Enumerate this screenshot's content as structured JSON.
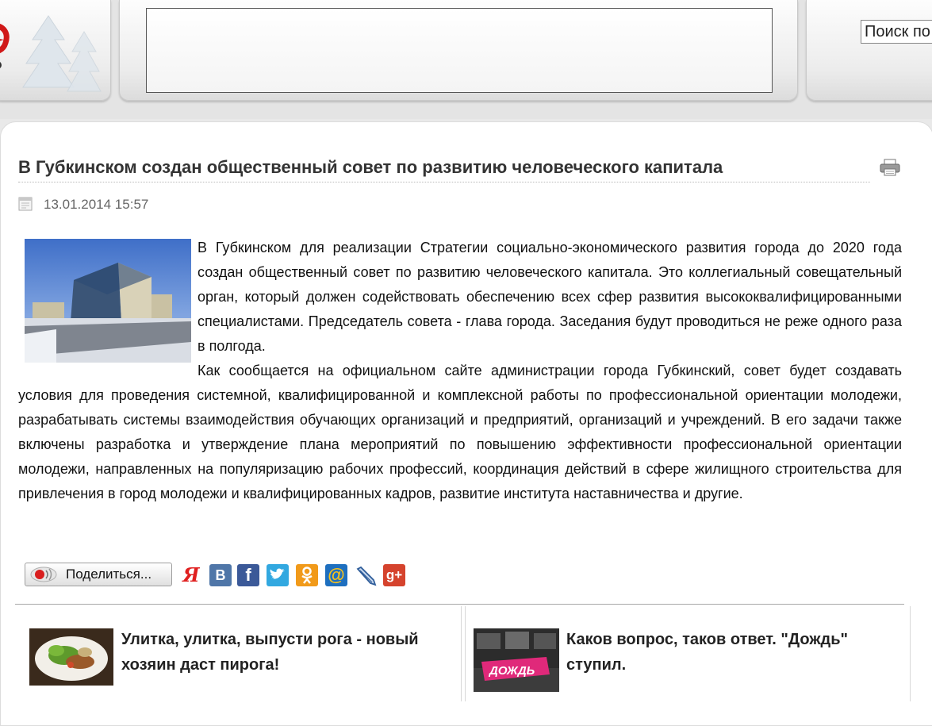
{
  "header": {
    "search_placeholder": "Поиск по сайту"
  },
  "article": {
    "title": "В Губкинском создан общественный совет по развитию человеческого капитала",
    "date": "13.01.2014 15:57",
    "paragraphs": [
      "В Губкинском для реализации Стратегии социально-экономического развития города до 2020 года создан общественный совет по развитию человеческого капитала. Это коллегиальный совещательный орган, который должен содействовать обеспечению всех сфер развития высококвалифицированными специалистами. Председатель совета - глава города. Заседания будут проводиться не реже одного раза в полгода.",
      "Как сообщается на официальном сайте администрации города Губкинский, совет будет создавать условия для проведения системной, квалифицированной и комплексной работы по профессиональной ориентации молодежи, разрабатывать системы взаимодействия обучающих организаций и предприятий, организаций и учреждений. В его задачи также включены разработка и утверждение плана мероприятий по повышению эффективности профессиональной ориентации молодежи, направленных на популяризацию рабочих профессий, координация действий в сфере жилищного строительства для привлечения в город молодежи и квалифицированных кадров, развитие института наставничества и другие."
    ]
  },
  "share": {
    "button_label": "Поделиться...",
    "icons": [
      {
        "name": "yandex",
        "glyph": "Я",
        "color": "#e02020"
      },
      {
        "name": "vkontakte",
        "glyph": "B",
        "color": "#4f76a8"
      },
      {
        "name": "facebook",
        "glyph": "f",
        "color": "#3b5998"
      },
      {
        "name": "twitter",
        "glyph": "t",
        "color": "#32a8e0"
      },
      {
        "name": "odnoklassniki",
        "glyph": "ок",
        "color": "#f19a1a"
      },
      {
        "name": "mail-ru",
        "glyph": "@",
        "color": "#1e6fbf"
      },
      {
        "name": "livejournal",
        "glyph": "✎",
        "color": "#3a6fa8"
      },
      {
        "name": "google-plus",
        "glyph": "g+",
        "color": "#d5432d"
      }
    ]
  },
  "related": [
    {
      "title": "Улитка, улитка, выпусти рога - новый хозяин даст пирога!"
    },
    {
      "title": "Каков вопрос, таков ответ. \"Дождь\" ступил.",
      "thumb_caption": "ДОЖДЬ"
    }
  ]
}
